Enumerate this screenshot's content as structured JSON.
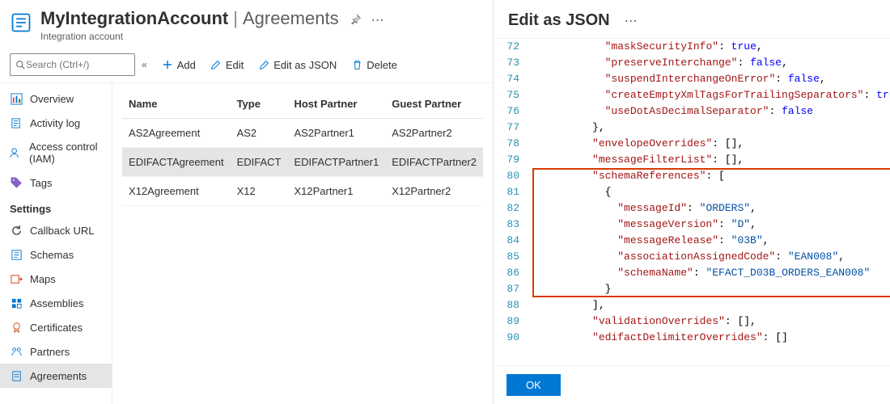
{
  "header": {
    "title": "MyIntegrationAccount",
    "section": "Agreements",
    "subtitle": "Integration account"
  },
  "search": {
    "placeholder": "Search (Ctrl+/)"
  },
  "commands": {
    "add": "Add",
    "edit": "Edit",
    "edit_json": "Edit as JSON",
    "delete": "Delete"
  },
  "nav": {
    "overview": "Overview",
    "activity": "Activity log",
    "access": "Access control (IAM)",
    "tags": "Tags",
    "settings_header": "Settings",
    "callback": "Callback URL",
    "schemas": "Schemas",
    "maps": "Maps",
    "assemblies": "Assemblies",
    "certificates": "Certificates",
    "partners": "Partners",
    "agreements": "Agreements"
  },
  "table": {
    "headers": {
      "name": "Name",
      "type": "Type",
      "host": "Host Partner",
      "guest": "Guest Partner"
    },
    "rows": [
      {
        "name": "AS2Agreement",
        "type": "AS2",
        "host": "AS2Partner1",
        "guest": "AS2Partner2"
      },
      {
        "name": "EDIFACTAgreement",
        "type": "EDIFACT",
        "host": "EDIFACTPartner1",
        "guest": "EDIFACTPartner2"
      },
      {
        "name": "X12Agreement",
        "type": "X12",
        "host": "X12Partner1",
        "guest": "X12Partner2"
      }
    ],
    "selected_index": 1
  },
  "right": {
    "title": "Edit as JSON",
    "ok": "OK",
    "lines": [
      {
        "n": 72,
        "indent": 6,
        "tokens": [
          [
            "key",
            "\"maskSecurityInfo\""
          ],
          [
            "punc",
            ": "
          ],
          [
            "bool",
            "true"
          ],
          [
            "punc",
            ","
          ]
        ]
      },
      {
        "n": 73,
        "indent": 6,
        "tokens": [
          [
            "key",
            "\"preserveInterchange\""
          ],
          [
            "punc",
            ": "
          ],
          [
            "bool",
            "false"
          ],
          [
            "punc",
            ","
          ]
        ]
      },
      {
        "n": 74,
        "indent": 6,
        "tokens": [
          [
            "key",
            "\"suspendInterchangeOnError\""
          ],
          [
            "punc",
            ": "
          ],
          [
            "bool",
            "false"
          ],
          [
            "punc",
            ","
          ]
        ]
      },
      {
        "n": 75,
        "indent": 6,
        "tokens": [
          [
            "key",
            "\"createEmptyXmlTagsForTrailingSeparators\""
          ],
          [
            "punc",
            ": "
          ],
          [
            "bool",
            "true"
          ],
          [
            "punc",
            ","
          ]
        ]
      },
      {
        "n": 76,
        "indent": 6,
        "tokens": [
          [
            "key",
            "\"useDotAsDecimalSeparator\""
          ],
          [
            "punc",
            ": "
          ],
          [
            "bool",
            "false"
          ]
        ]
      },
      {
        "n": 77,
        "indent": 5,
        "tokens": [
          [
            "punc",
            "},"
          ]
        ]
      },
      {
        "n": 78,
        "indent": 5,
        "tokens": [
          [
            "key",
            "\"envelopeOverrides\""
          ],
          [
            "punc",
            ": [],"
          ]
        ]
      },
      {
        "n": 79,
        "indent": 5,
        "tokens": [
          [
            "key",
            "\"messageFilterList\""
          ],
          [
            "punc",
            ": [],"
          ]
        ]
      },
      {
        "n": 80,
        "indent": 5,
        "tokens": [
          [
            "key",
            "\"schemaReferences\""
          ],
          [
            "punc",
            ": ["
          ]
        ]
      },
      {
        "n": 81,
        "indent": 6,
        "tokens": [
          [
            "punc",
            "{"
          ]
        ]
      },
      {
        "n": 82,
        "indent": 7,
        "tokens": [
          [
            "key",
            "\"messageId\""
          ],
          [
            "punc",
            ": "
          ],
          [
            "str",
            "\"ORDERS\""
          ],
          [
            "punc",
            ","
          ]
        ]
      },
      {
        "n": 83,
        "indent": 7,
        "tokens": [
          [
            "key",
            "\"messageVersion\""
          ],
          [
            "punc",
            ": "
          ],
          [
            "str",
            "\"D\""
          ],
          [
            "punc",
            ","
          ]
        ]
      },
      {
        "n": 84,
        "indent": 7,
        "tokens": [
          [
            "key",
            "\"messageRelease\""
          ],
          [
            "punc",
            ": "
          ],
          [
            "str",
            "\"03B\""
          ],
          [
            "punc",
            ","
          ]
        ]
      },
      {
        "n": 85,
        "indent": 7,
        "tokens": [
          [
            "key",
            "\"associationAssignedCode\""
          ],
          [
            "punc",
            ": "
          ],
          [
            "str",
            "\"EAN008\""
          ],
          [
            "punc",
            ","
          ]
        ]
      },
      {
        "n": 86,
        "indent": 7,
        "tokens": [
          [
            "key",
            "\"schemaName\""
          ],
          [
            "punc",
            ": "
          ],
          [
            "str",
            "\"EFACT_D03B_ORDERS_EAN008\""
          ]
        ]
      },
      {
        "n": 87,
        "indent": 6,
        "tokens": [
          [
            "punc",
            "}"
          ]
        ]
      },
      {
        "n": 88,
        "indent": 5,
        "tokens": [
          [
            "punc",
            "],"
          ]
        ]
      },
      {
        "n": 89,
        "indent": 5,
        "tokens": [
          [
            "key",
            "\"validationOverrides\""
          ],
          [
            "punc",
            ": [],"
          ]
        ]
      },
      {
        "n": 90,
        "indent": 5,
        "tokens": [
          [
            "key",
            "\"edifactDelimiterOverrides\""
          ],
          [
            "punc",
            ": []"
          ]
        ]
      }
    ],
    "highlight": {
      "from_line": 80,
      "to_line": 87
    }
  }
}
